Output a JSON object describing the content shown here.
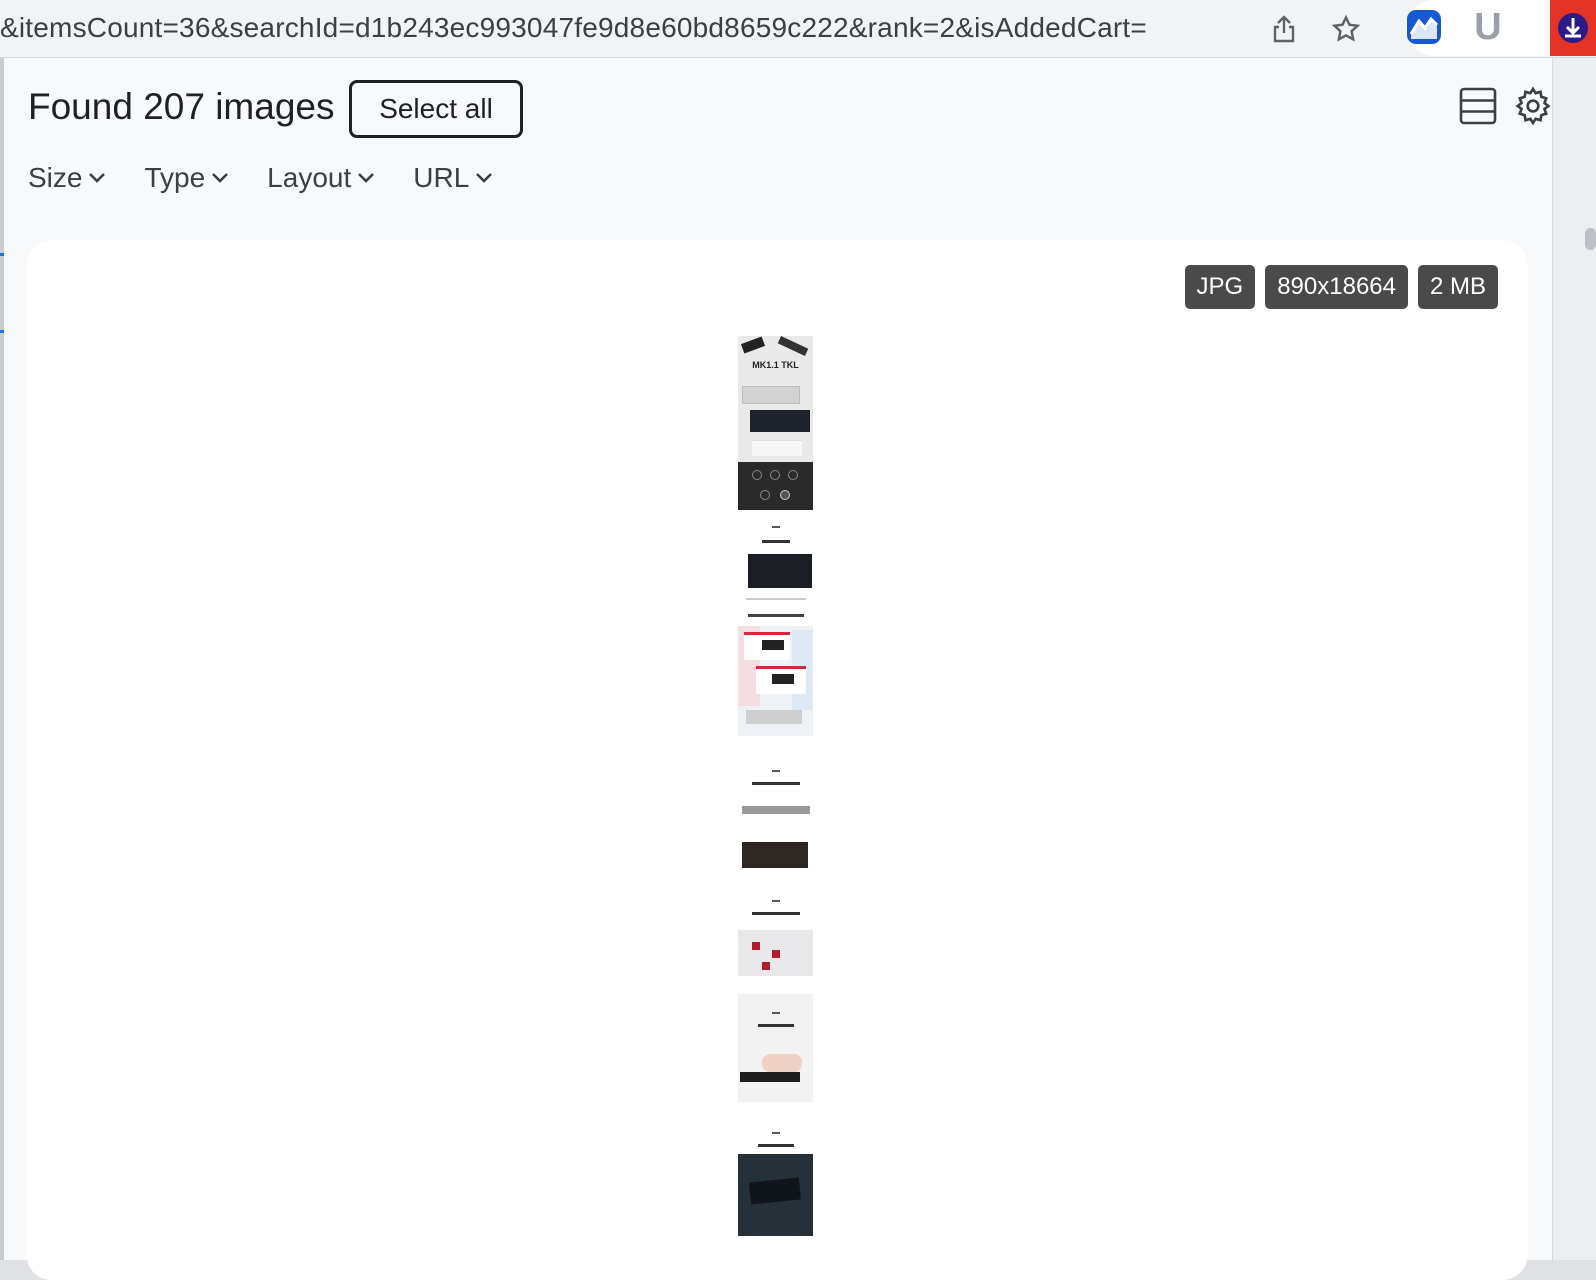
{
  "browser": {
    "url_visible": "&itemsCount=36&searchId=d1b243ec993047fe9d8e60bd8659c222&rank=2&isAddedCart=",
    "toolbar_icons": [
      "share-icon",
      "bookmark-star-icon"
    ],
    "extensions": [
      "stocks-extension-icon",
      "u-extension-icon",
      "image-downloader-extension-icon"
    ],
    "ext_u_letter": "U"
  },
  "popup": {
    "title": "Found 207 images",
    "select_all_label": "Select all",
    "header_icons": [
      "list-view-icon",
      "gear-icon"
    ],
    "filters": [
      {
        "label": "Size"
      },
      {
        "label": "Type"
      },
      {
        "label": "Layout"
      },
      {
        "label": "URL"
      }
    ]
  },
  "image_card": {
    "badges": [
      "JPG",
      "890x18664",
      "2 MB"
    ],
    "thumbnail_description_text": "MK1.1 TKL"
  },
  "colors": {
    "accent_blue": "#1a73e8",
    "badge_bg": "#4a4a4a",
    "ext_active_bg": "#e53426"
  }
}
